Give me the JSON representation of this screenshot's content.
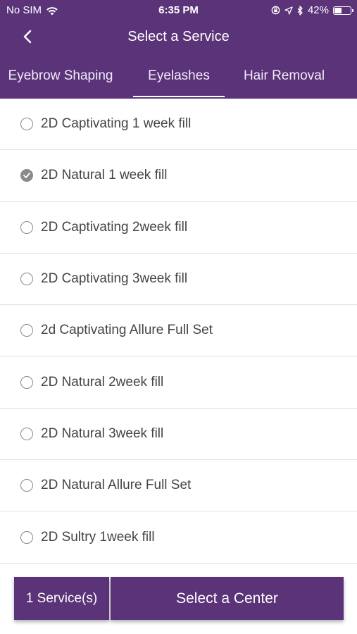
{
  "status_bar": {
    "carrier": "No SIM",
    "time": "6:35 PM",
    "battery_percent": "42%",
    "battery_level": 0.42,
    "icons": [
      "wifi-icon",
      "screen-rotation-lock-icon",
      "location-arrow-icon",
      "bluetooth-icon",
      "battery-icon"
    ]
  },
  "nav": {
    "title": "Select a Service",
    "back_icon": "chevron-left-icon"
  },
  "tabs": [
    {
      "label": "Eyebrow Shaping",
      "active": false
    },
    {
      "label": "Eyelashes",
      "active": true
    },
    {
      "label": "Hair Removal",
      "active": false
    }
  ],
  "services": [
    {
      "label": "2D Captivating 1 week fill",
      "selected": false
    },
    {
      "label": "2D Natural 1 week fill",
      "selected": true
    },
    {
      "label": "2D Captivating 2week fill",
      "selected": false
    },
    {
      "label": "2D Captivating 3week fill",
      "selected": false
    },
    {
      "label": "2d Captivating Allure Full Set",
      "selected": false
    },
    {
      "label": "2D Natural 2week fill",
      "selected": false
    },
    {
      "label": "2D Natural 3week fill",
      "selected": false
    },
    {
      "label": "2D Natural Allure Full Set",
      "selected": false
    },
    {
      "label": "2D Sultry 1week fill",
      "selected": false
    }
  ],
  "footer": {
    "count_label": "1 Service(s)",
    "cta_label": "Select a Center"
  },
  "colors": {
    "brand_purple": "#5b3379",
    "radio_gray": "#8a8a8a"
  }
}
